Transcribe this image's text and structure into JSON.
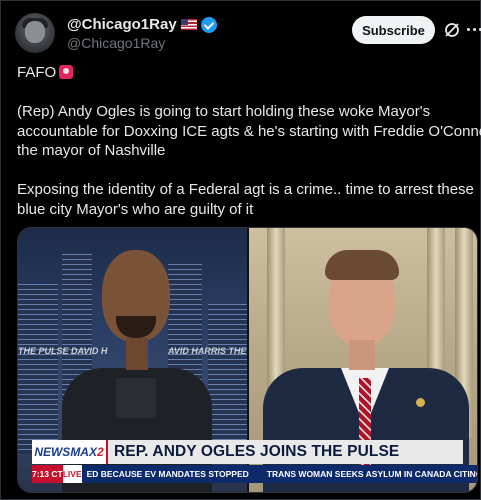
{
  "author": {
    "display_name": "@Chicago1Ray",
    "handle": "@Chicago1Ray",
    "verified": true,
    "flag": "us-flag-icon"
  },
  "actions": {
    "subscribe_label": "Subscribe",
    "grok_icon": "grok-icon",
    "more_icon": "more-icon"
  },
  "tweet": {
    "line1": "FAFO",
    "line2": "(Rep) Andy Ogles is going to start holding these woke Mayor's",
    "line3": "accountable for Doxxing ICE agts &  he's starting with Freddie O'Connell",
    "line4": "the mayor of Nashville",
    "line5": "Exposing the identity of a Federal agt is a crime.. time to arrest these",
    "line6": "blue city Mayor's who are guilty of it",
    "emoji": "siren-icon"
  },
  "media": {
    "left_tag": "THE PULSE  DAVID H",
    "left_tag2": "AVID HARRIS  THE",
    "logo_part1": "NEWSMAX",
    "logo_part2": "2",
    "headline": "REP. ANDY OGLES JOINS THE PULSE",
    "time": "7:13 CT",
    "live": "LIVE",
    "crawl1": "ED BECAUSE EV MANDATES STOPPED",
    "crawl2": "TRANS WOMAN SEEKS ASYLUM IN CANADA CITING T"
  },
  "colors": {
    "background": "#000000",
    "text": "#e7e9ea",
    "muted": "#71767b",
    "verified": "#1d9bf0",
    "newsmax_red": "#c8102e",
    "newsmax_blue": "#0d2a6b"
  }
}
